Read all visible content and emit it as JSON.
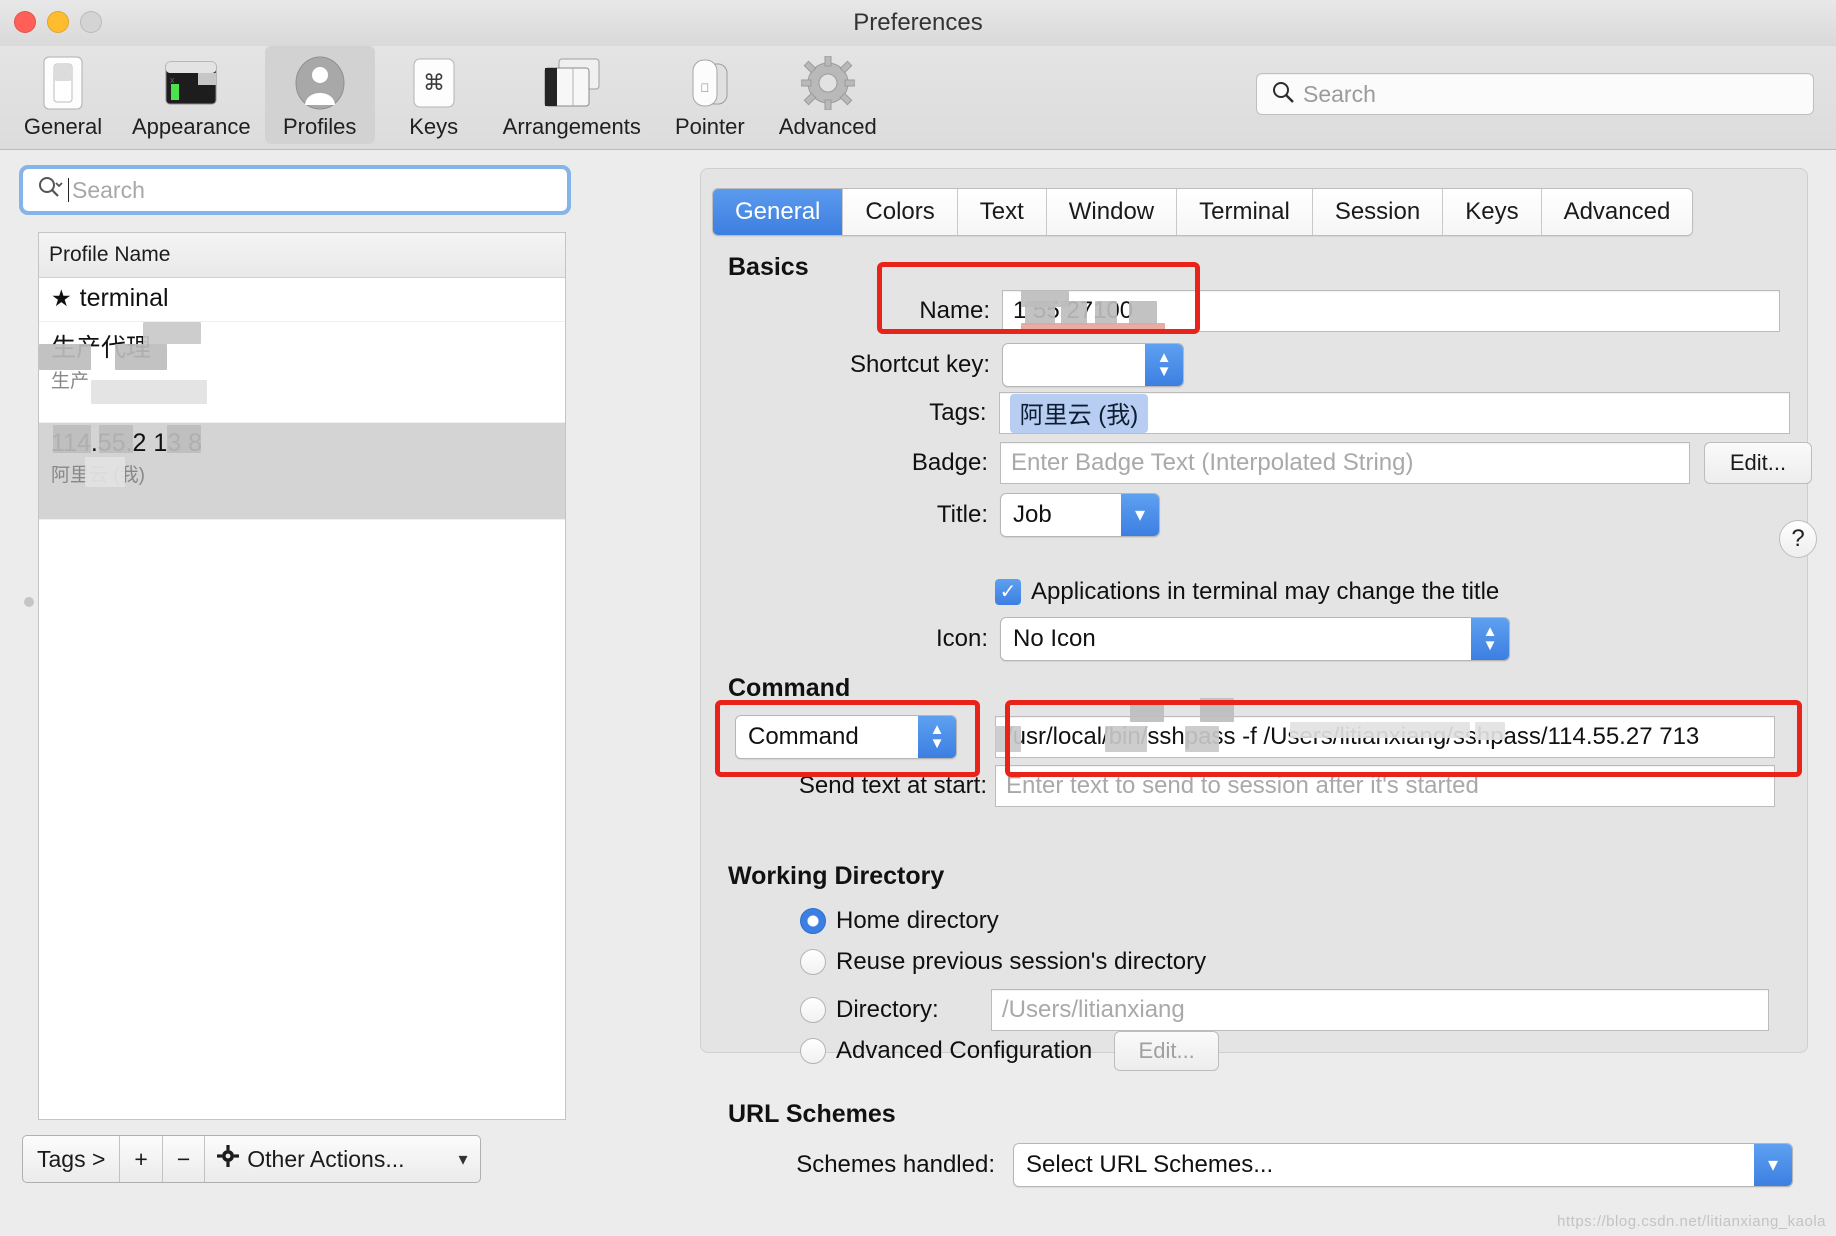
{
  "window": {
    "title": "Preferences"
  },
  "toolbar": {
    "items": [
      {
        "label": "General",
        "icon": "switch-icon"
      },
      {
        "label": "Appearance",
        "icon": "terminal-window-icon"
      },
      {
        "label": "Profiles",
        "icon": "person-icon"
      },
      {
        "label": "Keys",
        "icon": "command-key-icon"
      },
      {
        "label": "Arrangements",
        "icon": "windows-icon"
      },
      {
        "label": "Pointer",
        "icon": "mouse-icon"
      },
      {
        "label": "Advanced",
        "icon": "gear-icon"
      }
    ],
    "selected": "Profiles",
    "search_placeholder": "Search"
  },
  "profiles_panel": {
    "search_placeholder": "Search",
    "column_header": "Profile Name",
    "rows": [
      {
        "title": "terminal",
        "starred": true,
        "subtitle": "",
        "selected": false
      },
      {
        "title": "生产代理",
        "starred": false,
        "subtitle": "生产",
        "selected": false
      },
      {
        "title": "114.55.2  13 8",
        "starred": false,
        "subtitle": "阿里云 (我)",
        "selected": true
      }
    ],
    "bottom_bar": {
      "tags_label": "Tags >",
      "add_label": "+",
      "remove_label": "−",
      "other_actions_label": "Other Actions...",
      "gear_icon": "gear-icon",
      "chevron_icon": "chevron-down-icon"
    }
  },
  "tabs": [
    {
      "label": "General",
      "active": true
    },
    {
      "label": "Colors",
      "active": false
    },
    {
      "label": "Text",
      "active": false
    },
    {
      "label": "Window",
      "active": false
    },
    {
      "label": "Terminal",
      "active": false
    },
    {
      "label": "Session",
      "active": false
    },
    {
      "label": "Keys",
      "active": false
    },
    {
      "label": "Advanced",
      "active": false
    }
  ],
  "general": {
    "basics_heading": "Basics",
    "name_label": "Name:",
    "name_value": "1   55 27100",
    "shortcut_label": "Shortcut key:",
    "shortcut_value": "",
    "tags_label": "Tags:",
    "tag_chip": "阿里云 (我)",
    "badge_label": "Badge:",
    "badge_placeholder": "Enter Badge Text (Interpolated String)",
    "badge_edit_label": "Edit...",
    "title_label": "Title:",
    "title_value": "Job",
    "help_label": "?",
    "title_checkbox_label": "Applications in terminal may change the title",
    "title_checkbox_checked": true,
    "icon_label": "Icon:",
    "icon_value": "No Icon",
    "command_heading": "Command",
    "command_mode": "Command",
    "command_value": "/usr/local/bin/sshpass -f /Users/litianxiang/sshpass/114.55.27 713",
    "send_text_label": "Send text at start:",
    "send_text_placeholder": "Enter text to send to session after it's started",
    "working_dir_heading": "Working Directory",
    "wd_home": "Home directory",
    "wd_reuse": "Reuse previous session's directory",
    "wd_directory_label": "Directory:",
    "wd_directory_placeholder": "/Users/litianxiang",
    "wd_advanced": "Advanced Configuration",
    "wd_advanced_edit": "Edit...",
    "wd_selected": "Home directory",
    "url_heading": "URL Schemes",
    "schemes_label": "Schemes handled:",
    "schemes_value": "Select URL Schemes..."
  },
  "annotations": {
    "accent_color": "#e8241a",
    "boxes": [
      "name-field",
      "command-popup",
      "command-field"
    ]
  },
  "watermark": "https://blog.csdn.net/litianxiang_kaola"
}
